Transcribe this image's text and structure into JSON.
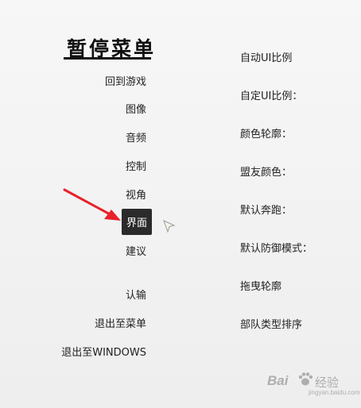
{
  "pause_menu": {
    "title": "暂停菜单",
    "items": [
      {
        "label": "回到游戏",
        "selected": false
      },
      {
        "label": "图像",
        "selected": false
      },
      {
        "label": "音频",
        "selected": false
      },
      {
        "label": "控制",
        "selected": false
      },
      {
        "label": "视角",
        "selected": false
      },
      {
        "label": "界面",
        "selected": true
      },
      {
        "label": "建议",
        "selected": false
      },
      {
        "label": "认输",
        "selected": false
      },
      {
        "label": "退出至菜单",
        "selected": false
      },
      {
        "label": "退出至WINDOWS",
        "selected": false
      }
    ]
  },
  "interface_settings": {
    "items": [
      {
        "label": "自动UI比例"
      },
      {
        "label": "自定UI比例："
      },
      {
        "label": "颜色轮廓："
      },
      {
        "label": "盟友颜色："
      },
      {
        "label": "默认奔跑："
      },
      {
        "label": "默认防御模式："
      },
      {
        "label": "拖曳轮廓"
      },
      {
        "label": "部队类型排序"
      }
    ]
  },
  "annotations": {
    "arrow_icon": "red-arrow-icon",
    "arrow_color": "#e8212a",
    "cursor_icon": "mouse-cursor-icon"
  },
  "watermark": {
    "logo": "Bai",
    "site": "经验",
    "url": "jingyan.baidu.com"
  },
  "colors": {
    "background": "#f3f3f3",
    "text": "#222222",
    "selected_bg": "#2b2b2b",
    "selected_text": "#ffffff"
  }
}
